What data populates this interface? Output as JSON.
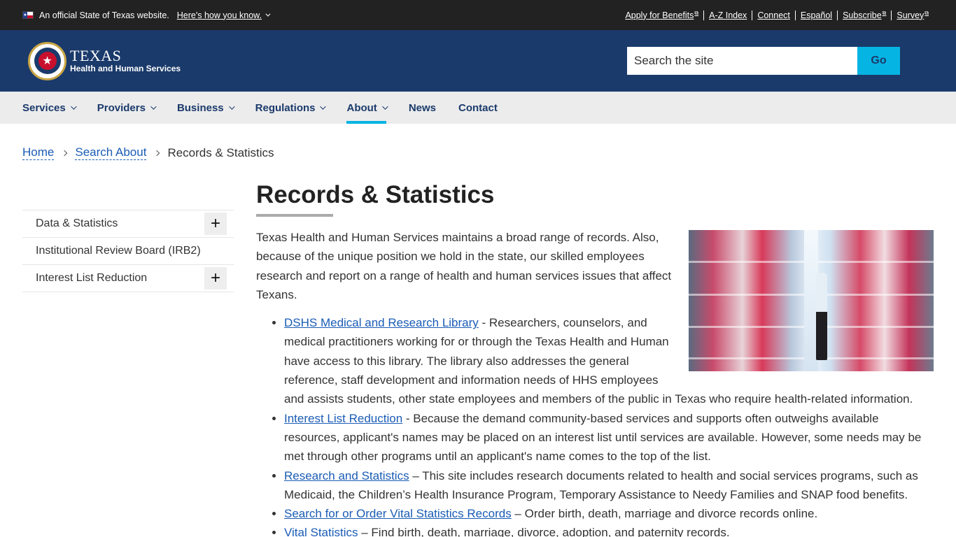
{
  "gov_bar": {
    "official_text": "An official State of Texas website.",
    "how_to_know": "Here's how you know.",
    "links": [
      {
        "label": "Apply for Benefits",
        "external": true
      },
      {
        "label": "A-Z Index",
        "external": false
      },
      {
        "label": "Connect",
        "external": false
      },
      {
        "label": "Español",
        "external": false
      },
      {
        "label": "Subscribe",
        "external": true
      },
      {
        "label": "Survey",
        "external": true
      }
    ]
  },
  "header": {
    "logo_line1": "TEXAS",
    "logo_line2": "Health and Human Services",
    "search_placeholder": "Search the site",
    "search_button": "Go"
  },
  "nav": {
    "items": [
      {
        "label": "Services",
        "dropdown": true,
        "active": false
      },
      {
        "label": "Providers",
        "dropdown": true,
        "active": false
      },
      {
        "label": "Business",
        "dropdown": true,
        "active": false
      },
      {
        "label": "Regulations",
        "dropdown": true,
        "active": false
      },
      {
        "label": "About",
        "dropdown": true,
        "active": true
      },
      {
        "label": "News",
        "dropdown": false,
        "active": false
      },
      {
        "label": "Contact",
        "dropdown": false,
        "active": false
      }
    ]
  },
  "breadcrumb": {
    "items": [
      "Home",
      "Search About"
    ],
    "current": "Records & Statistics"
  },
  "sidebar": {
    "items": [
      {
        "label": "Data & Statistics",
        "expandable": true
      },
      {
        "label": "Institutional Review Board (IRB2)",
        "expandable": false
      },
      {
        "label": "Interest List Reduction",
        "expandable": true
      }
    ]
  },
  "main": {
    "title": "Records & Statistics",
    "intro": "Texas Health and Human Services maintains a broad range of records. Also, because of the unique position we hold in the state, our skilled employees research and report on a range of health and human services issues that affect Texans.",
    "list": [
      {
        "link": "DSHS Medical and Research Library",
        "text": " - Researchers, counselors, and medical practitioners working for or through the Texas Health and Human have access to this library. The library also addresses the general reference, staff development and information needs of HHS employees and assists students, other state employees and members of the public in Texas who require health-related information."
      },
      {
        "link": "Interest List Reduction",
        "text": " - Because the demand community-based services and supports often outweighs available resources, applicant's names may be placed on an interest list until services are available. However, some needs may be met through other programs until an applicant's name comes to the top of the list."
      },
      {
        "link": "Research and Statistics",
        "text": " – This site includes research documents related to health and social services programs, such as Medicaid, the Children’s Health Insurance Program, Temporary Assistance to Needy Families and SNAP food benefits."
      },
      {
        "link": "Search for or Order Vital Statistics Records",
        "text": " – Order birth, death, marriage and divorce records online."
      },
      {
        "link": "Vital Statistics",
        "text": " – Find birth, death, marriage, divorce, adoption, and paternity records."
      }
    ]
  },
  "colors": {
    "header_bg": "#1a3a6b",
    "accent": "#06b4e3",
    "link": "#1a5cb5"
  }
}
